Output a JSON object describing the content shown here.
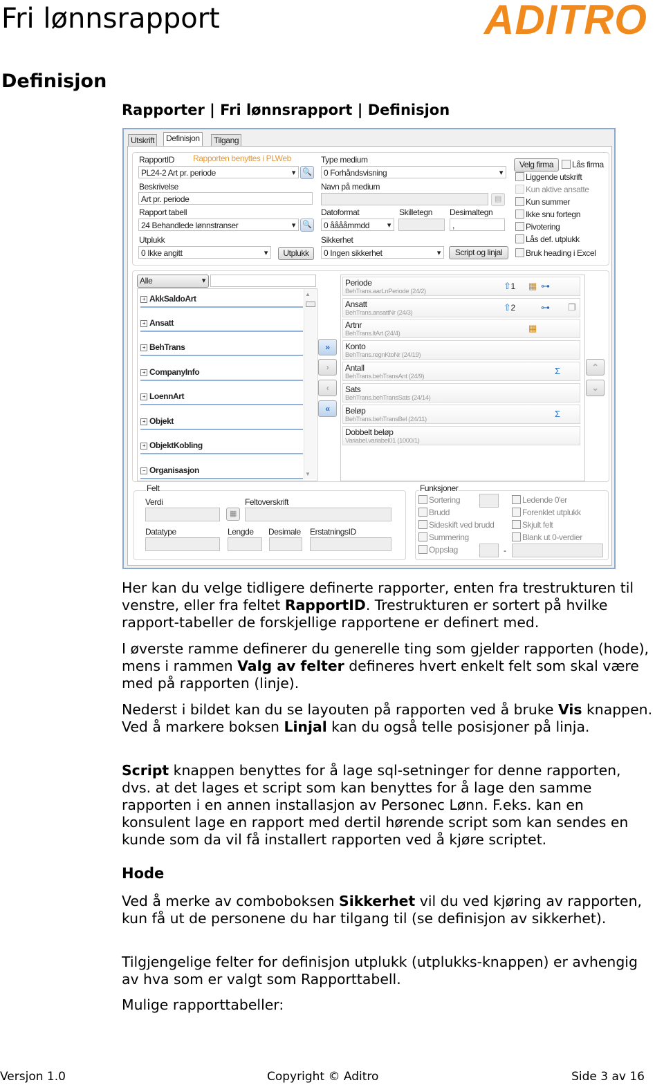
{
  "header": {
    "title": "Fri lønnsrapport",
    "logo": "ADITRO",
    "logo_color": "#f08a1c"
  },
  "section_title": "Definisjon",
  "breadcrumb": "Rapporter | Fri lønnsrapport | Definisjon",
  "screenshot": {
    "tabs": [
      "Utskrift",
      "Definisjon",
      "Tilgang"
    ],
    "active_tab": "Definisjon",
    "rapportid_label": "RapportID",
    "pl_note": "Rapporten benyttes i PLWeb",
    "rapportid_value": "PL24-2 Art pr. periode",
    "beskrivelse_label": "Beskrivelse",
    "beskrivelse_value": "Art pr. periode",
    "rapport_tabell_label": "Rapport tabell",
    "rapport_tabell_value": "24 Behandlede lønnstranser",
    "utplukk_label": "Utplukk",
    "utplukk_value": "0 Ikke angitt",
    "utplukk_button": "Utplukk",
    "type_medium_label": "Type medium",
    "type_medium_value": "0 Forhåndsvisning",
    "navn_medium_label": "Navn på medium",
    "datoformat_label": "Datoformat",
    "datoformat_value": "0 ååååmmdd",
    "skilletegn_label": "Skilletegn",
    "desimaltegn_label": "Desimaltegn",
    "desimaltegn_value": ",",
    "sikkerhet_label": "Sikkerhet",
    "sikkerhet_value": "0 Ingen sikkerhet",
    "script_button": "Script og linjal",
    "velg_firma_button": "Velg firma",
    "las_firma": "Lås firma",
    "options": [
      "Liggende utskrift",
      "Kun aktive ansatte",
      "Kun summer",
      "Ikke snu fortegn",
      "Pivotering",
      "Lås def. utplukk",
      "Bruk heading i Excel"
    ],
    "filter_value": "Alle",
    "tree": [
      {
        "label": "AkkSaldoArt",
        "expander": "+"
      },
      {
        "label": "Ansatt",
        "expander": "+"
      },
      {
        "label": "BehTrans",
        "expander": "+"
      },
      {
        "label": "CompanyInfo",
        "expander": "+"
      },
      {
        "label": "LoennArt",
        "expander": "+"
      },
      {
        "label": "Objekt",
        "expander": "+"
      },
      {
        "label": "ObjektKobling",
        "expander": "+"
      },
      {
        "label": "Organisasjon",
        "expander": "−"
      }
    ],
    "fields": [
      {
        "name": "Periode",
        "source": "BehTrans.aarLnPeriode (24/2)",
        "sort": "1"
      },
      {
        "name": "Ansatt",
        "source": "BehTrans.ansattNr (24/3)",
        "sort": "2"
      },
      {
        "name": "Artnr",
        "source": "BehTrans.ltArt (24/4)"
      },
      {
        "name": "Konto",
        "source": "BehTrans.regnKtoNr (24/19)"
      },
      {
        "name": "Antall",
        "source": "BehTrans.behTransAnt (24/9)"
      },
      {
        "name": "Sats",
        "source": "BehTrans.behTransSats (24/14)"
      },
      {
        "name": "Beløp",
        "source": "BehTrans.behTransBel (24/11)"
      },
      {
        "name": "Dobbelt beløp",
        "source": "Variabel.variabel01 (1000/1)"
      }
    ],
    "felt": {
      "title": "Felt",
      "verdi": "Verdi",
      "feltoverskrift": "Feltoverskrift",
      "datatype": "Datatype",
      "lengde": "Lengde",
      "desimale": "Desimale",
      "erstatningsid": "ErstatningsID"
    },
    "funksjoner": {
      "title": "Funksjoner",
      "left": [
        "Sortering",
        "Brudd",
        "Sideskift ved brudd",
        "Summering",
        "Oppslag"
      ],
      "right": [
        "Ledende 0'er",
        "Forenklet utplukk",
        "Skjult felt",
        "Blank ut 0-verdier"
      ],
      "dash": "-"
    }
  },
  "body": {
    "p1": [
      "Her kan du velge tidligere definerte rapporter, enten fra trestrukturen til venstre, eller fra feltet ",
      "RapportID",
      ". Trestrukturen er sortert på hvilke rapport-tabeller de forskjellige rapportene er definert med."
    ],
    "p2": [
      "I øverste ramme definerer du generelle ting som gjelder rapporten (hode), mens i rammen ",
      "Valg av felter",
      " defineres hvert enkelt felt som skal være med på rapporten (linje)."
    ],
    "p3": [
      "Nederst i bildet kan du se layouten på rapporten ved å bruke ",
      "Vis",
      " knappen. Ved å markere boksen ",
      "Linjal",
      " kan du også telle posisjoner på linja."
    ],
    "p4": [
      "Script",
      " knappen benyttes for å lage sql-setninger for denne rapporten, dvs. at det lages et script som kan benyttes for å lage den samme rapporten i en annen installasjon av Personec Lønn. F.eks. kan en konsulent lage en rapport med dertil hørende script som kan sendes en kunde som da vil få installert rapporten ved å kjøre scriptet."
    ],
    "hode": "Hode",
    "p5": [
      "Ved å merke av comboboksen ",
      "Sikkerhet",
      " vil du ved kjøring av rapporten, kun få ut de personene du har tilgang til (se definisjon av sikkerhet)."
    ],
    "p6": "Tilgjengelige felter for definisjon utplukk (utplukks-knappen) er avhengig av hva som er valgt som Rapporttabell.",
    "p7": "Mulige rapporttabeller:"
  },
  "footer": {
    "version": "Versjon 1.0",
    "copyright": "Copyright © Aditro",
    "page": "Side 3 av 16"
  }
}
